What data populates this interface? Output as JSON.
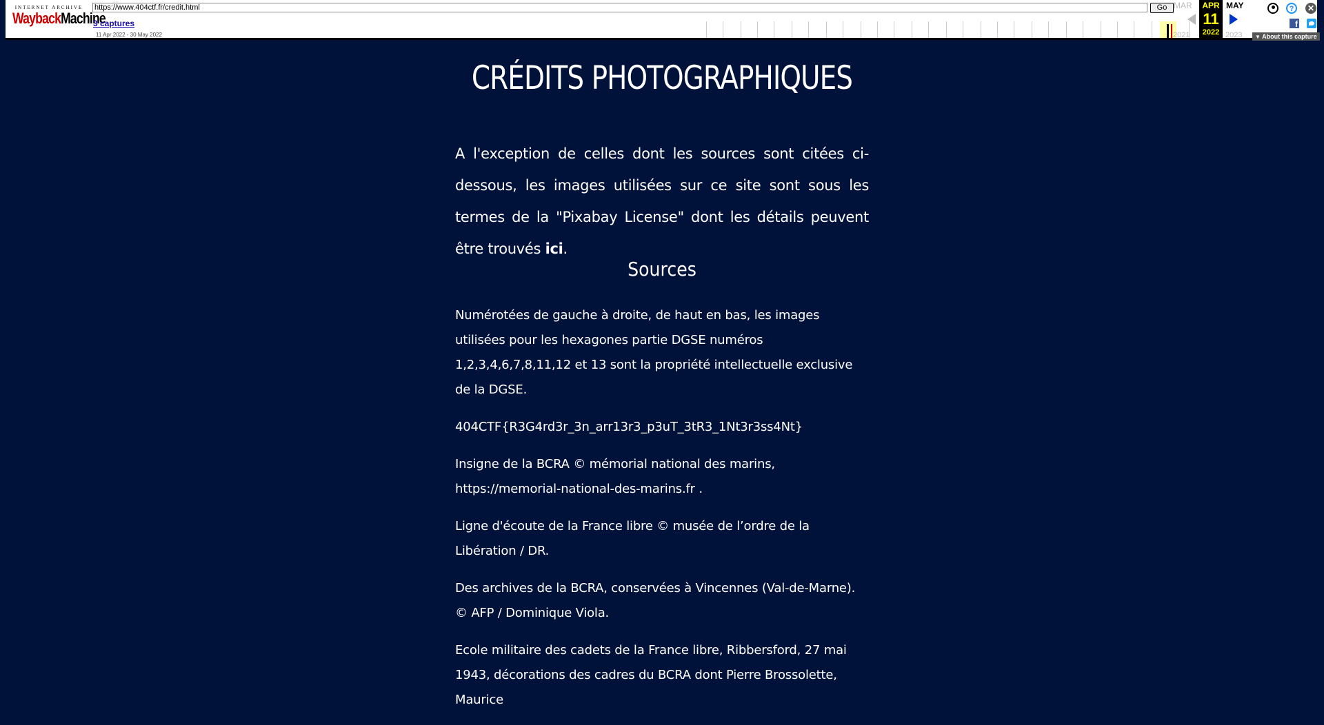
{
  "wayback": {
    "logo_top": "INTERNET ARCHIVE",
    "logo_main_a": "Wayback",
    "logo_main_b": "Machine",
    "url": "https://www.404ctf.fr/credit.html",
    "go_label": "Go",
    "captures_label": "3 captures",
    "date_range": "11 Apr 2022 - 30 May 2022",
    "prev_month": "MAR",
    "current_month": "APR",
    "next_month": "MAY",
    "current_day": "11",
    "prev_year": "2021",
    "current_year": "2022",
    "next_year": "2023",
    "about_label": "About this capture"
  },
  "page": {
    "title": "CRÉDITS PHOTOGRAPHIQUES",
    "intro_text": "A l'exception de celles dont les sources sont citées ci-dessous, les images utilisées sur ce site sont sous les termes de la \"Pixabay License\" dont les détails peuvent être trouvés ",
    "intro_link": "ici",
    "intro_end": ".",
    "sources_heading": "Sources",
    "sources": [
      "Numérotées de gauche à droite, de haut en bas, les images utilisées pour les hexagones partie DGSE numéros 1,2,3,4,6,7,8,11,12 et 13 sont la propriété intellectuelle exclusive de la DGSE.",
      "404CTF{R3G4rd3r_3n_arr13r3_p3uT_3tR3_1Nt3r3ss4Nt}",
      "Insigne de la BCRA © mémorial national des marins, https://memorial-national-des-marins.fr .",
      "Ligne d'écoute de la France libre © musée de l’ordre de la Libération / DR.",
      "Des archives de la BCRA, conservées à Vincennes (Val-de-Marne). © AFP / Dominique Viola.",
      "Ecole militaire des cadets de la France libre, Ribbersford, 27 mai 1943, décorations des cadres du BCRA dont Pierre Brossolette, Maurice"
    ]
  }
}
